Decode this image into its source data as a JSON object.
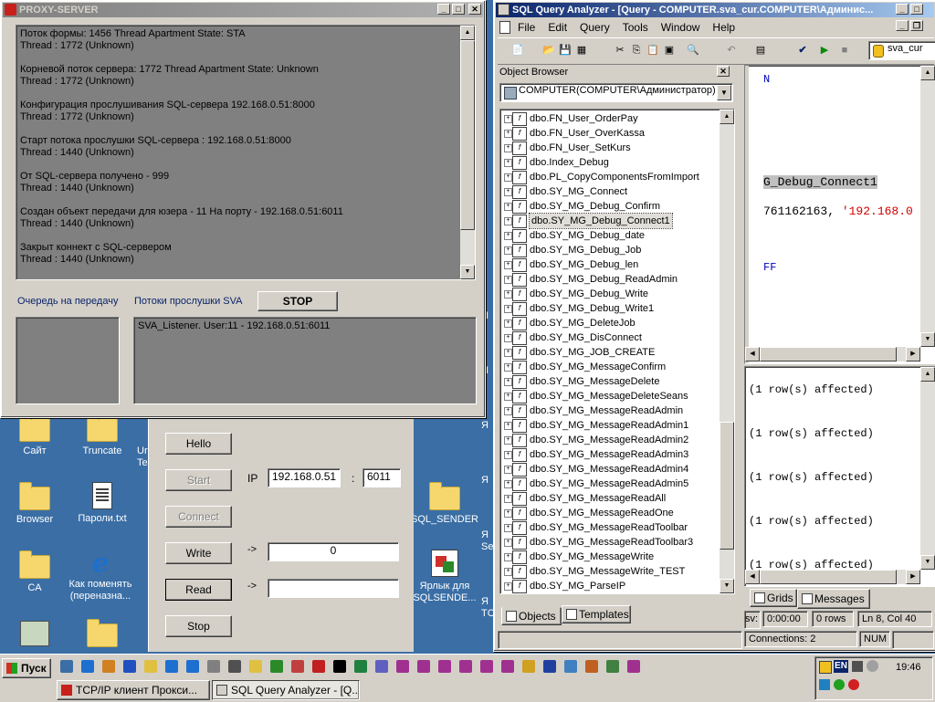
{
  "desktop": {
    "icons": [
      {
        "label": "Сайт",
        "type": "folder"
      },
      {
        "label": "Truncate",
        "type": "folder"
      },
      {
        "label": "Browser",
        "type": "folder"
      },
      {
        "label": "Пароли.txt",
        "type": "text-file"
      },
      {
        "label": "CA",
        "type": "folder"
      },
      {
        "label": "Как поменять (переназна...",
        "type": "ie"
      },
      {
        "label": "SQL_SENDER",
        "type": "folder"
      },
      {
        "label": "Ярлык для SQLSENDE...",
        "type": "shortcut"
      }
    ],
    "partial_labels": {
      "ur": "Ur",
      "te": "Te",
      "ya": "Я",
      "ser": "Ser",
      "to": "TC"
    }
  },
  "proxy": {
    "title": "PROXY-SERVER",
    "log": [
      [
        "Поток формы: 1456  Thread Apartment State: STA",
        "Thread : 1772 (Unknown)"
      ],
      [
        "Корневой поток сервера: 1772  Thread Apartment State: Unknown",
        "Thread : 1772 (Unknown)"
      ],
      [
        "Конфигурация прослушивания SQL-сервера  192.168.0.51:8000",
        "Thread : 1772 (Unknown)"
      ],
      [
        "Старт потока прослушки SQL-сервера : 192.168.0.51:8000",
        "Thread : 1440 (Unknown)"
      ],
      [
        "От SQL-сервера получено - 999",
        "Thread : 1440 (Unknown)"
      ],
      [
        "Создан объект передачи для юзера - 11 На порту - 192.168.0.51:6011",
        "Thread : 1440 (Unknown)"
      ],
      [
        "Закрыт коннект с SQL-сервером",
        "Thread : 1440 (Unknown)"
      ]
    ],
    "queue_label": "Очередь на передачу",
    "threads_label": "Потоки прослушки  SVA",
    "stop_label": "STOP",
    "listener": "SVA_Listener. User:11 - 192.168.0.51:6011"
  },
  "client": {
    "hello": "Hello",
    "start": "Start",
    "connect": "Connect",
    "write": "Write",
    "read": "Read",
    "stop": "Stop",
    "ip_label": "IP",
    "ip_value": "192.168.0.51",
    "colon": ":",
    "port_value": "6011",
    "arrow": "->",
    "write_value": "0",
    "read_value": ""
  },
  "qa": {
    "title": "SQL Query Analyzer - [Query - COMPUTER.sva_cur.COMPUTER\\Админис...",
    "menu": [
      "File",
      "Edit",
      "Query",
      "Tools",
      "Window",
      "Help"
    ],
    "db_select": "sva_cur",
    "ob_title": "Object Browser",
    "ob_server": "COMPUTER(COMPUTER\\Администратор)",
    "tree": [
      "dbo.FN_User_OrderPay",
      "dbo.FN_User_OverKassa",
      "dbo.FN_User_SetKurs",
      "dbo.Index_Debug",
      "dbo.PL_CopyComponentsFromImport",
      "dbo.SY_MG_Connect",
      "dbo.SY_MG_Debug_Confirm",
      "dbo.SY_MG_Debug_Connect1",
      "dbo.SY_MG_Debug_date",
      "dbo.SY_MG_Debug_Job",
      "dbo.SY_MG_Debug_len",
      "dbo.SY_MG_Debug_ReadAdmin",
      "dbo.SY_MG_Debug_Write",
      "dbo.SY_MG_Debug_Write1",
      "dbo.SY_MG_DeleteJob",
      "dbo.SY_MG_DisConnect",
      "dbo.SY_MG_JOB_CREATE",
      "dbo.SY_MG_MessageConfirm",
      "dbo.SY_MG_MessageDelete",
      "dbo.SY_MG_MessageDeleteSeans",
      "dbo.SY_MG_MessageReadAdmin",
      "dbo.SY_MG_MessageReadAdmin1",
      "dbo.SY_MG_MessageReadAdmin2",
      "dbo.SY_MG_MessageReadAdmin3",
      "dbo.SY_MG_MessageReadAdmin4",
      "dbo.SY_MG_MessageReadAdmin5",
      "dbo.SY_MG_MessageReadAll",
      "dbo.SY_MG_MessageReadOne",
      "dbo.SY_MG_MessageReadToolbar",
      "dbo.SY_MG_MessageReadToolbar3",
      "dbo.SY_MG_MessageWrite",
      "dbo.SY_MG_MessageWrite_TEST",
      "dbo.SY_MG_ParseIP"
    ],
    "selected_index": 7,
    "tab_objects": "Objects",
    "tab_templates": "Templates",
    "query_lines": {
      "l1": "N",
      "l2": "G_Debug_Connect1",
      "l3a": "761162163, ",
      "l3b": "'192.168.0",
      "l4": "FF"
    },
    "messages": [
      "(1 row(s) affected)",
      "(1 row(s) affected)",
      "(1 row(s) affected)",
      "(1 row(s) affected)",
      "(1 row(s) affected)"
    ],
    "tab_grids": "Grids",
    "tab_messages": "Messages",
    "status": {
      "user": "sv:",
      "time": "0:00:00",
      "rows": "0 rows",
      "pos": "Ln 8, Col 40",
      "connections": "Connections: 2",
      "num": "NUM"
    }
  },
  "taskbar": {
    "start": "Пуск",
    "tasks": [
      "TCP/IP клиент Прокси...",
      "SQL Query Analyzer - [Q..."
    ],
    "clock": "19:46",
    "lang": "EN"
  }
}
